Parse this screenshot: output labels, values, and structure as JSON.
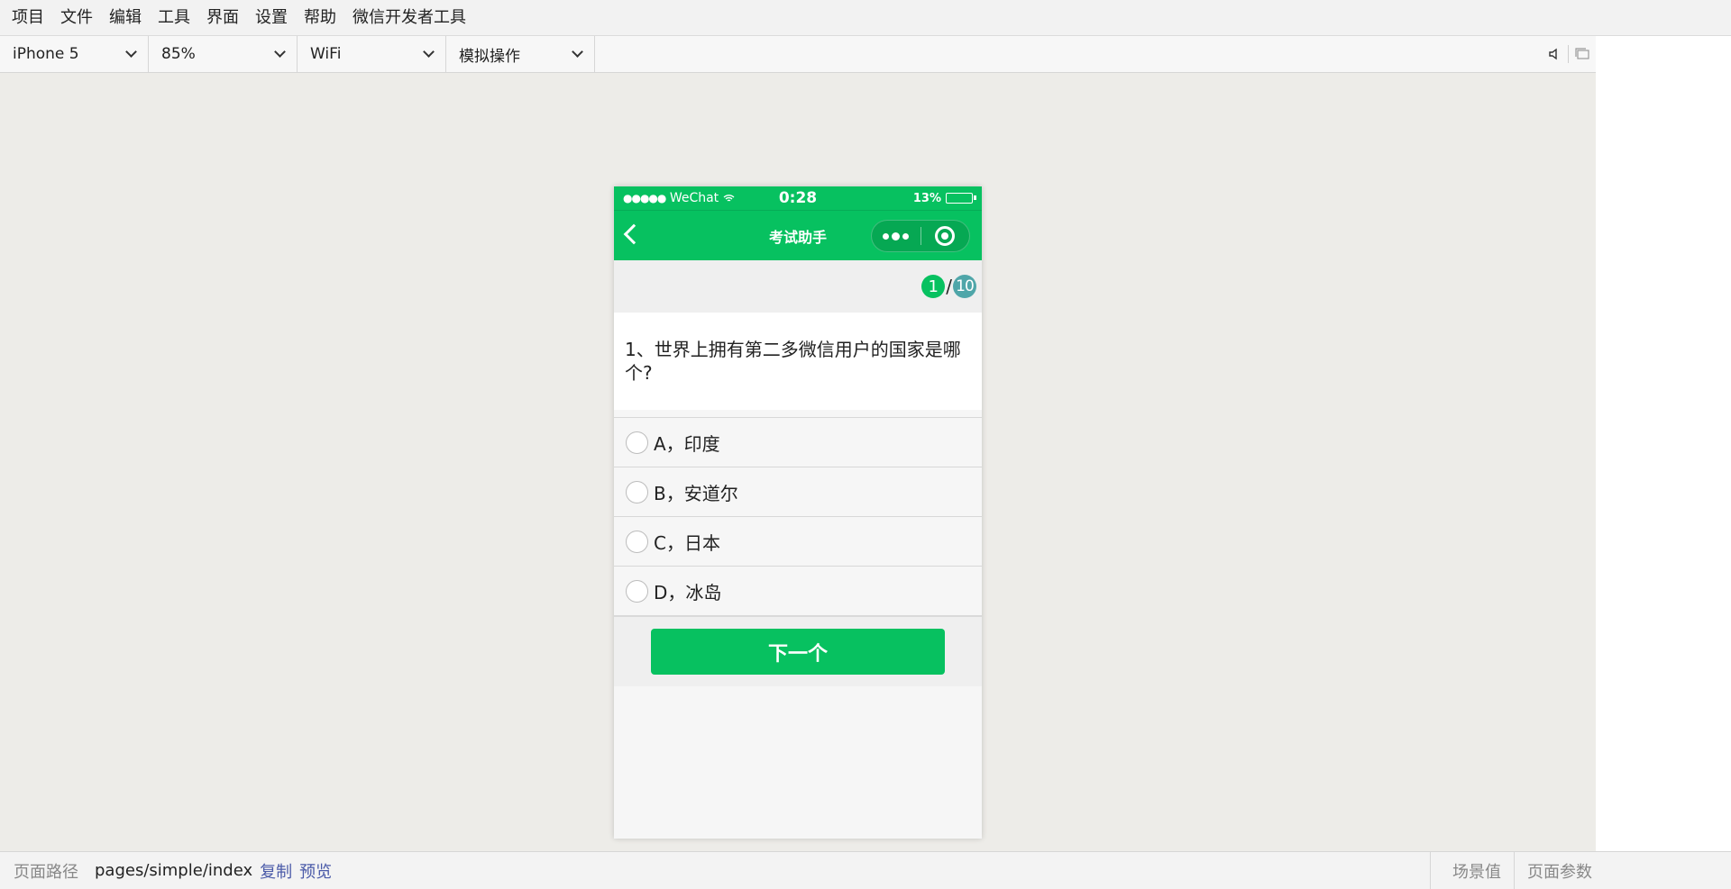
{
  "menubar": {
    "items": [
      "项目",
      "文件",
      "编辑",
      "工具",
      "界面",
      "设置",
      "帮助",
      "微信开发者工具"
    ]
  },
  "toolbar": {
    "device": "iPhone 5",
    "zoom": "85%",
    "network": "WiFi",
    "operation": "模拟操作",
    "icons": [
      "volume-icon",
      "window-icon"
    ]
  },
  "phone": {
    "status": {
      "signal": "●●●●●",
      "carrier": "WeChat",
      "time": "0:28",
      "battery": "13%",
      "battery_level": 0.13
    },
    "nav": {
      "title": "考试助手"
    },
    "progress": {
      "current": "1",
      "separator": "/",
      "total": "10"
    },
    "question": "1、世界上拥有第二多微信用户的国家是哪个?",
    "options": [
      "A，印度",
      "B，安道尔",
      "C，日本",
      "D，冰岛"
    ],
    "next_button": "下一个"
  },
  "bottombar": {
    "path_label": "页面路径",
    "path": "pages/simple/index",
    "copy": "复制",
    "preview": "预览",
    "scene": "场景值",
    "params": "页面参数"
  },
  "colors": {
    "accent": "#07c160",
    "total_badge": "#4fa6a9",
    "link": "#4a5aa8"
  }
}
